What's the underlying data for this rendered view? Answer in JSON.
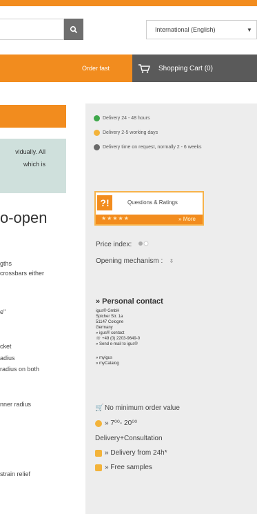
{
  "header": {
    "search_placeholder": "",
    "language": "International (English)",
    "order_fast": "Order fast",
    "cart_label": "Shopping Cart (0)"
  },
  "notice": {
    "line1": "vidually. All",
    "line2": "which is"
  },
  "heading": "o-open",
  "specs": [
    "gths",
    "crossbars either",
    "e\"",
    "cket",
    "adius",
    "radius on both",
    "nner radius",
    "strain relief"
  ],
  "delivery": [
    {
      "label": "Delivery 24 - 48 hours",
      "color": "#3fa84b"
    },
    {
      "label": "Delivery 2-5 working days",
      "color": "#f3b33a"
    },
    {
      "label": "Delivery time on request, normally 2 - 6 weeks",
      "color": "#6a6a6a"
    }
  ],
  "ratings": {
    "title": "Questions & Ratings",
    "stars": "★★★★★",
    "more": "» More"
  },
  "price_index": "Price index:",
  "opening": "Opening mechanism :",
  "contact": {
    "title": "» Personal contact",
    "lines": [
      "igus® GmbH",
      "Spicher Str. 1a",
      "51147 Cologne",
      "Germany",
      "» igus® contact",
      "☏ +49 (0) 2203-9649-0",
      "» Send e-mail to igus®"
    ],
    "links": [
      "» myigus",
      "» myCatalog"
    ]
  },
  "features": {
    "min_order": "No minimum order value",
    "hours": "» 7⁰⁰- 20⁰⁰",
    "consult": "Delivery+Consultation",
    "delivery_from": "» Delivery from 24h*",
    "samples": "» Free samples"
  },
  "colors": {
    "accent": "#f28c1e",
    "nav": "#5a5a5a",
    "panel": "#ededed"
  }
}
